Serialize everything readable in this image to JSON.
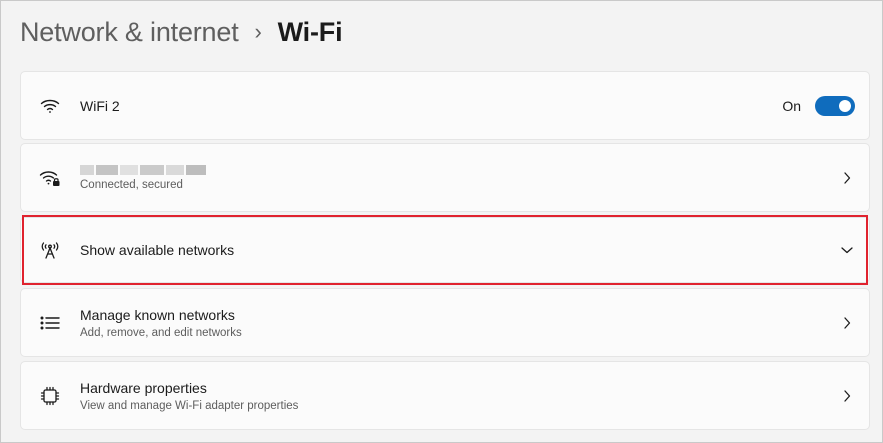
{
  "breadcrumb": {
    "parent": "Network & internet",
    "separator": "›",
    "current": "Wi-Fi"
  },
  "wifi_toggle": {
    "title": "WiFi 2",
    "state_label": "On",
    "enabled": true,
    "icon": "wifi-icon"
  },
  "connected_network": {
    "name": "",
    "status": "Connected, secured",
    "icon": "wifi-secured-icon"
  },
  "available_networks": {
    "title": "Show available networks",
    "icon": "antenna-icon",
    "expanded": false
  },
  "known_networks": {
    "title": "Manage known networks",
    "subtitle": "Add, remove, and edit networks",
    "icon": "list-icon"
  },
  "hardware": {
    "title": "Hardware properties",
    "subtitle": "View and manage Wi-Fi adapter properties",
    "icon": "chip-icon"
  },
  "colors": {
    "accent": "#0f6cbd",
    "highlight": "#e0222e"
  }
}
